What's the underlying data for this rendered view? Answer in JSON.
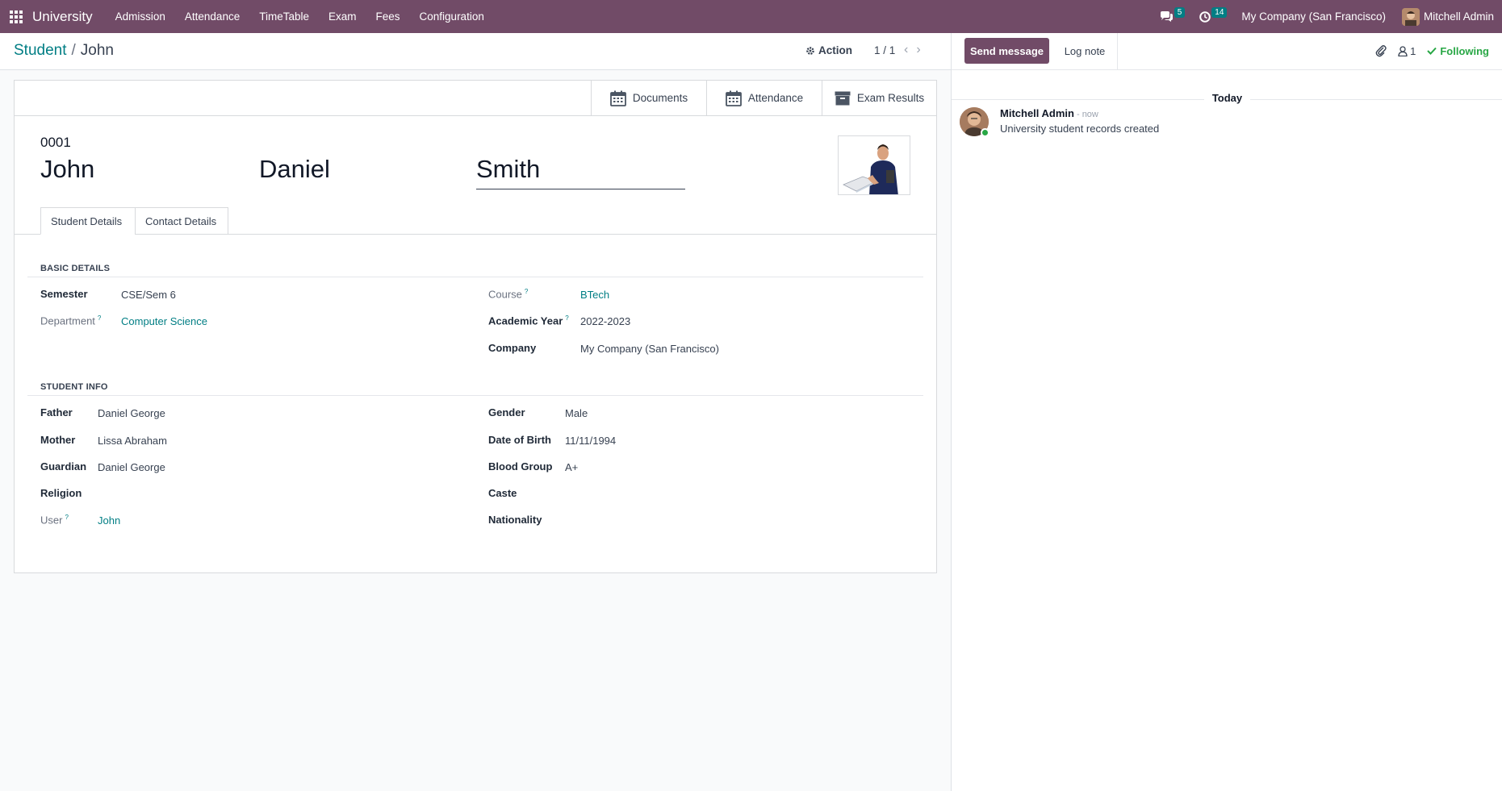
{
  "navbar": {
    "brand": "University",
    "menu": [
      "Admission",
      "Attendance",
      "TimeTable",
      "Exam",
      "Fees",
      "Configuration"
    ],
    "messages_count": "5",
    "activities_count": "14",
    "company": "My Company (San Francisco)",
    "user": "Mitchell Admin"
  },
  "control": {
    "breadcrumb_parent": "Student",
    "breadcrumb_sep": "/",
    "breadcrumb_current": "John",
    "action_label": "Action",
    "pager": "1 / 1"
  },
  "smart_buttons": [
    "Documents",
    "Attendance",
    "Exam Results"
  ],
  "student": {
    "ref": "0001",
    "first_name": "John",
    "middle_name": "Daniel",
    "last_name": "Smith"
  },
  "tabs": [
    "Student Details",
    "Contact Details"
  ],
  "basic_details": {
    "title": "BASIC DETAILS",
    "semester_label": "Semester",
    "semester": "CSE/Sem 6",
    "department_label": "Department",
    "department": "Computer Science",
    "course_label": "Course",
    "course": "BTech",
    "academic_year_label": "Academic Year",
    "academic_year": "2022-2023",
    "company_label": "Company",
    "company": "My Company (San Francisco)",
    "help_mark": "?"
  },
  "student_info": {
    "title": "STUDENT INFO",
    "father_label": "Father",
    "father": "Daniel George",
    "mother_label": "Mother",
    "mother": "Lissa Abraham",
    "guardian_label": "Guardian",
    "guardian": "Daniel George",
    "religion_label": "Religion",
    "user_label": "User",
    "user": "John",
    "gender_label": "Gender",
    "gender": "Male",
    "dob_label": "Date of Birth",
    "dob": "11/11/1994",
    "blood_group_label": "Blood Group",
    "blood_group": "A+",
    "caste_label": "Caste",
    "nationality_label": "Nationality"
  },
  "chatter": {
    "send_message": "Send message",
    "log_note": "Log note",
    "followers_count": "1",
    "following": "Following",
    "day": "Today",
    "message": {
      "author": "Mitchell Admin",
      "time": "- now",
      "body": "University student records created"
    }
  },
  "colors": {
    "brand": "#714b67",
    "link": "#017e84",
    "following": "#28a745"
  }
}
